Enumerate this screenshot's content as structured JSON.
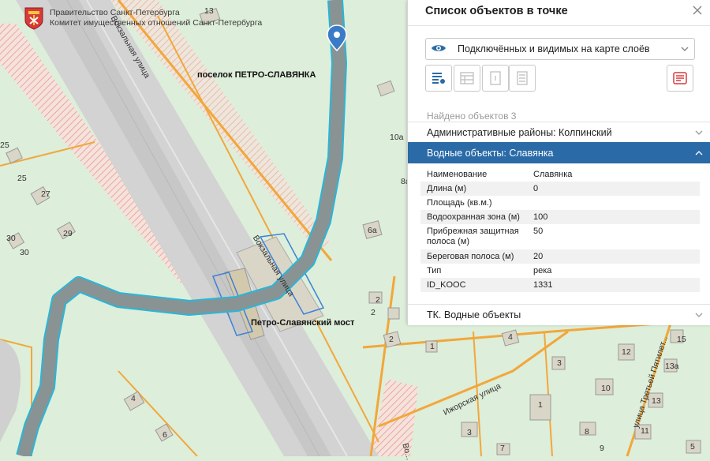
{
  "header": {
    "line1": "Правительство Санкт-Петербурга",
    "line2": "Комитет имущественных отношений Санкт-Петербурга"
  },
  "map": {
    "settlement_label": "поселок ПЕТРО-СЛАВЯНКА",
    "bridge_label": "Петро-Славянский мост",
    "streets": {
      "vokzalnaya_top": "Вокзальная улица",
      "vokzalnaya_mid": "Вокзальная улица",
      "izhorskaya": "Ижорская улица",
      "tretya_pyatiletka": "улица Третьей Пятилет...",
      "bottom_partial": "Во..."
    },
    "house_numbers": {
      "n13_top": "13",
      "n25a": "25",
      "n25b": "25",
      "n27": "27",
      "n29": "29",
      "n30a": "30",
      "n30b": "30",
      "n10a": "10а",
      "n8a": "8а",
      "n6a": "6а",
      "n2a": "2",
      "n2b": "2",
      "n2c": "2",
      "n1a": "1",
      "n4a": "4",
      "n3": "3",
      "n12": "12",
      "n15": "15",
      "n13a": "13а",
      "n10": "10",
      "n13": "13",
      "n1b": "1",
      "n8": "8",
      "n11": "11",
      "n4b": "4",
      "n5": "5",
      "n6": "6",
      "n3b": "3",
      "n7": "7",
      "n9": "9"
    }
  },
  "panel": {
    "title": "Список объектов в точке",
    "layer_select_value": "Подключённых и видимых на карте слоёв",
    "found_text": "Найдено объектов 3",
    "sections": [
      {
        "label": "Административные районы: Колпинский"
      },
      {
        "label": "Водные объекты: Славянка"
      },
      {
        "label": "ТК. Водные объекты"
      }
    ],
    "attributes": [
      {
        "key": "Наименование",
        "value": "Славянка"
      },
      {
        "key": "Длина (м)",
        "value": "0"
      },
      {
        "key": "Площадь (кв.м.)",
        "value": ""
      },
      {
        "key": "Водоохранная зона (м)",
        "value": "100"
      },
      {
        "key": "Прибрежная защитная полоса (м)",
        "value": "50"
      },
      {
        "key": "Береговая полоса (м)",
        "value": "20"
      },
      {
        "key": "Тип",
        "value": "река"
      },
      {
        "key": "ID_KOOC",
        "value": "1331"
      }
    ]
  },
  "colors": {
    "map_bg": "#ddeeda",
    "river": "#8a9393",
    "river_outline": "#29b6d8",
    "road": "#f2a73a",
    "rail": "#cfd0cf",
    "accent": "#2a6aa7",
    "pin": "#3a7bc8",
    "red_icon": "#d83a3a"
  }
}
